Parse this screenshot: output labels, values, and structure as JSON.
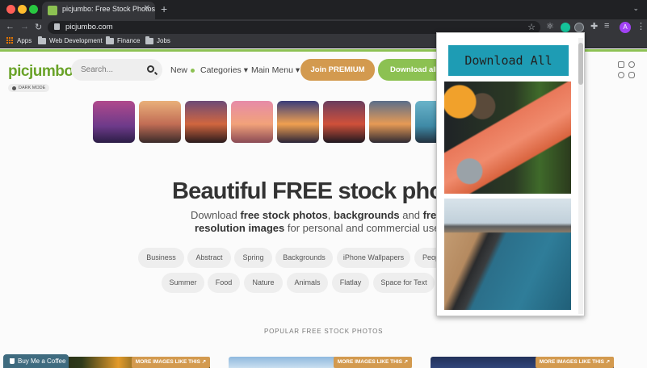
{
  "browser": {
    "tab_title": "picjumbo: Free Stock Photos",
    "url": "picjumbo.com",
    "profile_initial": "A",
    "bookmarks": [
      "Apps",
      "Web Development",
      "Finance",
      "Jobs"
    ],
    "icons": [
      "back-icon",
      "forward-icon",
      "reload-icon",
      "lock-icon",
      "star-icon",
      "extensions-icon",
      "menu-icon"
    ]
  },
  "site": {
    "logo": "picjumbo",
    "dark_mode_label": "DARK MODE",
    "search_placeholder": "Search...",
    "nav": {
      "new": "New",
      "categories": "Categories ▾",
      "main_menu": "Main Menu ▾"
    },
    "join_premium": "Join PREMIUM",
    "download_all": "Download all",
    "hero": {
      "title": "Beautiful FREE stock phot",
      "sub_pre": "Download ",
      "sub_b1": "free stock photos",
      "sub_mid": ", ",
      "sub_b2": "backgrounds",
      "sub_and": " and ",
      "sub_b3": "free hig",
      "sub2_b": "resolution images",
      "sub2_rest": " for personal and commercial use"
    },
    "tags_row1": [
      "Business",
      "Abstract",
      "Spring",
      "Backgrounds",
      "iPhone Wallpapers",
      "Peop"
    ],
    "tags_row2": [
      "Summer",
      "Food",
      "Nature",
      "Animals",
      "Flatlay",
      "Space for Text"
    ],
    "popular_heading": "POPULAR FREE STOCK PHOTOS",
    "more_images": [
      "MORE IMAGES LIKE THIS ↗",
      "MORE IMAGES LIKE THIS ↗",
      "MORE IMAGES LIKE THIS ↗"
    ],
    "buy_coffee": "Buy Me a Coffee"
  },
  "popup": {
    "download_all": "Download All"
  },
  "colors": {
    "brand_green": "#8cc152",
    "premium_orange": "#d39a4f",
    "popup_button": "#1e9cb4"
  }
}
